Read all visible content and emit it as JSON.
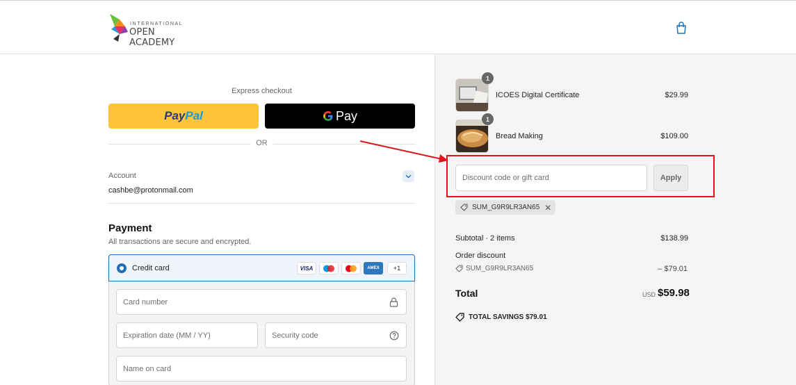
{
  "header": {
    "logo_small": "INTERNATIONAL",
    "logo_big": "OPEN ACADEMY"
  },
  "express": {
    "label": "Express checkout",
    "paypal_pay": "Pay",
    "paypal_pal": "Pal",
    "gpay_label": "Pay",
    "or_label": "OR"
  },
  "account": {
    "label": "Account",
    "email": "cashbe@protonmail.com"
  },
  "payment": {
    "title": "Payment",
    "subtitle": "All transactions are secure and encrypted.",
    "method_label": "Credit card",
    "brands": {
      "visa": "VISA",
      "amex": "AMEX",
      "more": "+1"
    },
    "card_number_placeholder": "Card number",
    "expiration_placeholder": "Expiration date (MM / YY)",
    "security_placeholder": "Security code",
    "name_placeholder": "Name on card"
  },
  "cart": {
    "items": [
      {
        "name": "ICOES Digital Certificate",
        "price": "$29.99",
        "qty": "1"
      },
      {
        "name": "Bread Making",
        "price": "$109.00",
        "qty": "1"
      }
    ],
    "discount_placeholder": "Discount code or gift card",
    "apply_label": "Apply",
    "applied_code": "SUM_G9R9LR3AN65",
    "remove_symbol": "✕"
  },
  "summary": {
    "subtotal_label": "Subtotal · 2 items",
    "subtotal_value": "$138.99",
    "order_discount_label": "Order discount",
    "discount_code": "SUM_G9R9LR3AN65",
    "discount_value": "– $79.01",
    "total_label": "Total",
    "total_currency": "USD",
    "total_value": "$59.98",
    "savings_label": "TOTAL SAVINGS",
    "savings_value": "$79.01"
  },
  "colors": {
    "accent": "#1f6fb8",
    "paypal_yellow": "#ffc439",
    "annotation_red": "#e0141d"
  },
  "icons": {
    "cart": "shopping-bag-icon",
    "chevron": "chevron-down-icon",
    "lock": "lock-icon",
    "help": "question-circle-icon",
    "tag": "tag-icon"
  }
}
